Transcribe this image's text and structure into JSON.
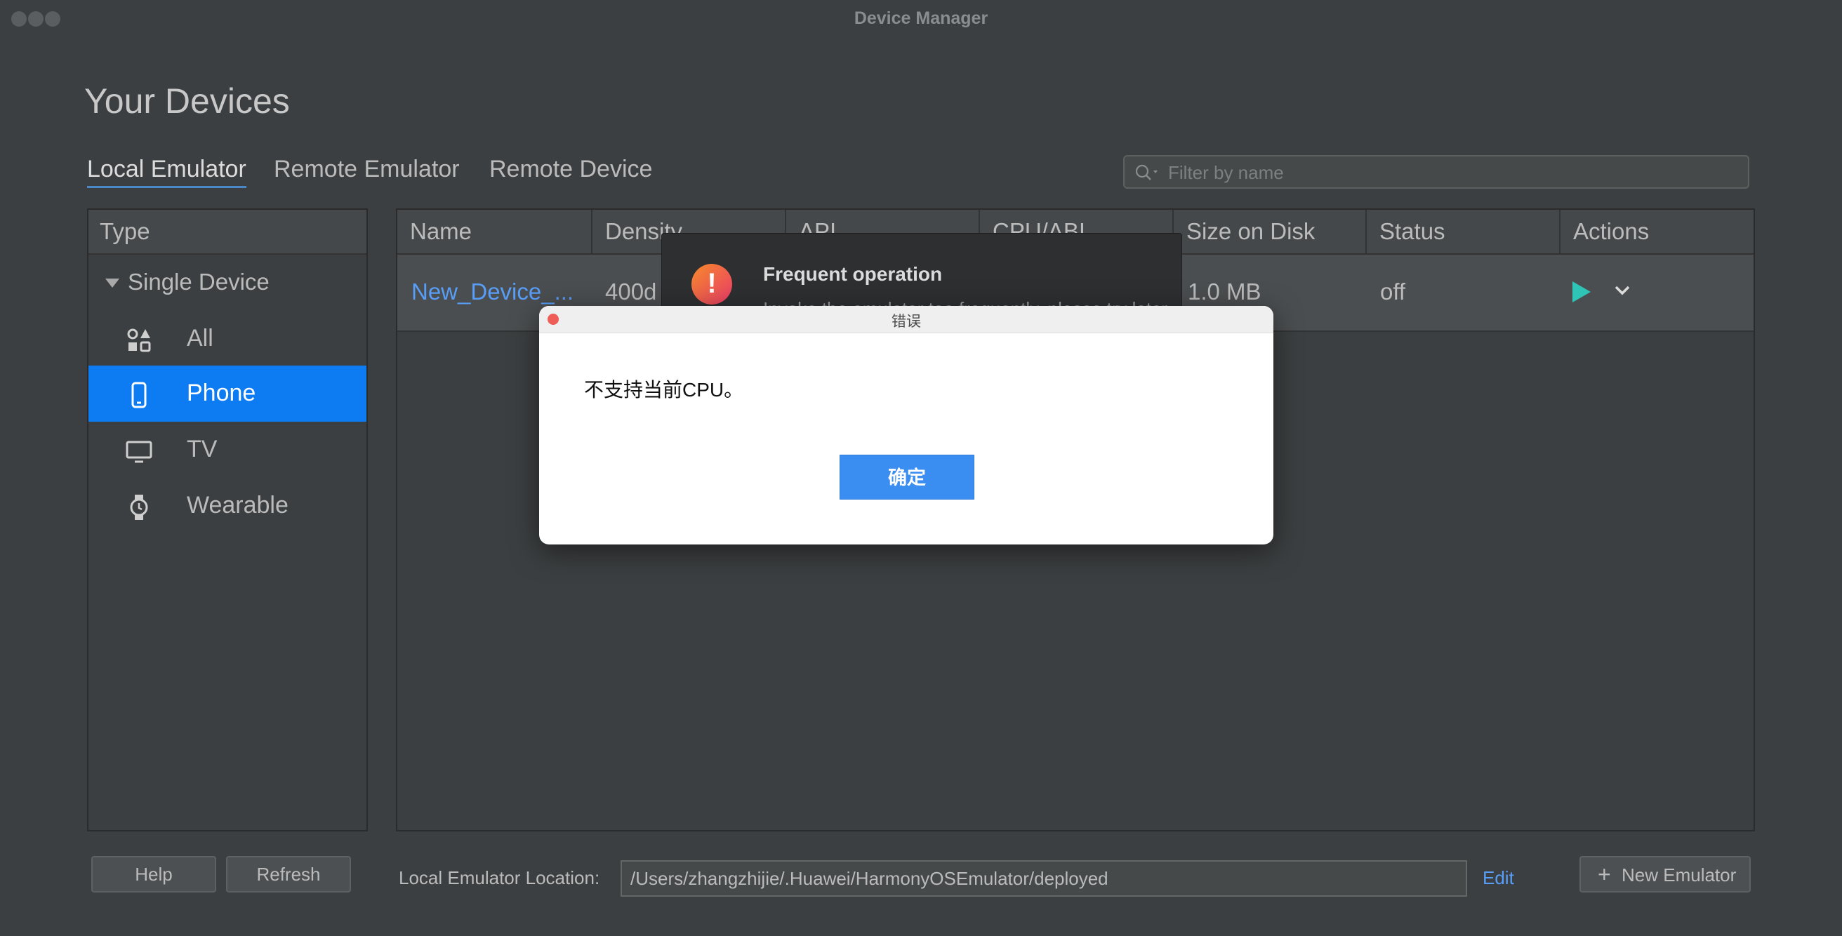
{
  "window": {
    "title": "Device Manager"
  },
  "page": {
    "heading": "Your Devices"
  },
  "tabs": [
    {
      "label": "Local Emulator",
      "active": true
    },
    {
      "label": "Remote Emulator",
      "active": false
    },
    {
      "label": "Remote Device",
      "active": false
    }
  ],
  "search": {
    "placeholder": "Filter by name"
  },
  "type_panel": {
    "header": "Type",
    "group": "Single Device",
    "items": [
      {
        "label": "All",
        "icon": "grid-shapes-icon"
      },
      {
        "label": "Phone",
        "icon": "phone-icon",
        "selected": true
      },
      {
        "label": "TV",
        "icon": "tv-icon"
      },
      {
        "label": "Wearable",
        "icon": "watch-icon"
      }
    ]
  },
  "table": {
    "columns": [
      "Name",
      "Density",
      "API",
      "CPU/ABI",
      "Size on Disk",
      "Status",
      "Actions"
    ],
    "rows": [
      {
        "name": "New_Device_...",
        "density": "400d",
        "size": "1.0 MB",
        "status": "off"
      }
    ]
  },
  "notification": {
    "title": "Frequent operation",
    "body": "Invoke the emulator too frequently, please try later"
  },
  "dialog": {
    "title": "错误",
    "message": "不支持当前CPU。",
    "ok_label": "确定"
  },
  "footer": {
    "help_label": "Help",
    "refresh_label": "Refresh",
    "location_label": "Local Emulator Location:",
    "location_value": "/Users/zhangzhijie/.Huawei/HarmonyOSEmulator/deployed",
    "edit_label": "Edit",
    "new_emulator_label": "New Emulator"
  },
  "colors": {
    "background": "#3c3f41",
    "accent_selected": "#0d7bf2",
    "link": "#589df6",
    "play": "#2ec4b6",
    "dialog_button": "#3a8ef2"
  }
}
